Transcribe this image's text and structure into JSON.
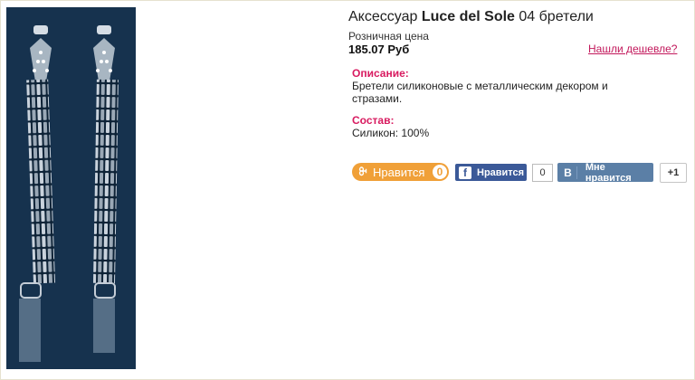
{
  "product": {
    "title_prefix": "Аксессуар ",
    "brand": "Luce del Sole",
    "title_suffix": " 04 бретели",
    "price_label": "Розничная цена",
    "price": "185.07 Руб",
    "cheaper_link": "Нашли дешевле?"
  },
  "description": {
    "heading": "Описание:",
    "text_line1": "Бретели силиконовые с металлическим декором и",
    "text_line2": "стразами."
  },
  "composition": {
    "heading": "Состав:",
    "text": "Силикон: 100%"
  },
  "social": {
    "ok": {
      "icon_glyph": "ꔬ",
      "label": "Нравится",
      "count": "0",
      "color": "#f0a038"
    },
    "facebook": {
      "icon_glyph": "f",
      "label": "Нравится",
      "count": "0",
      "color": "#3b5998"
    },
    "vk": {
      "icon_glyph": "В",
      "label": "Мне нравится",
      "count": "+1",
      "color": "#5b7fa6"
    }
  }
}
